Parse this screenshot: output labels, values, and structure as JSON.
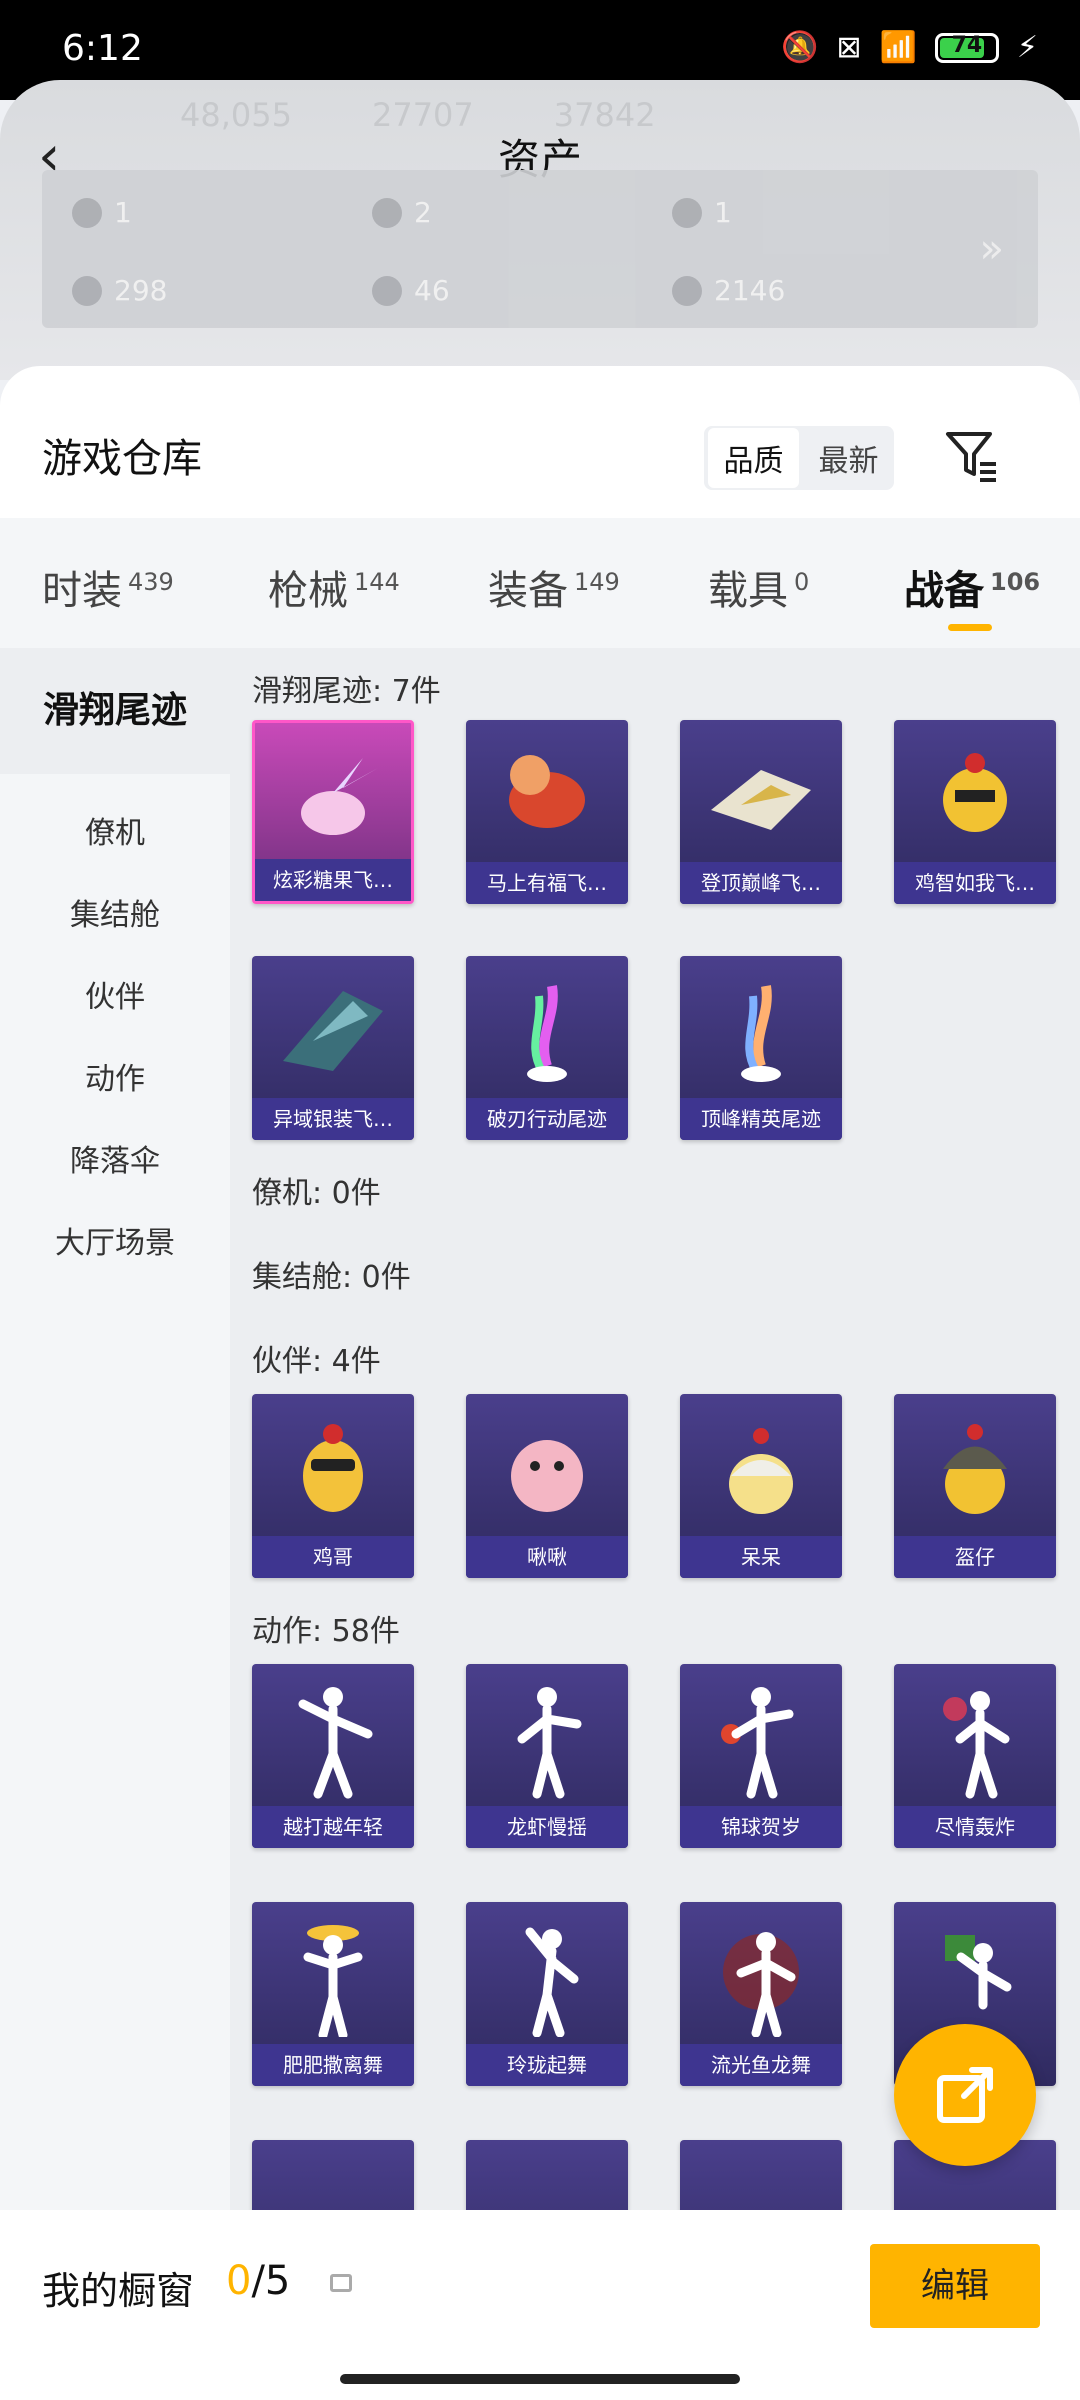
{
  "status_bar": {
    "time": "6:12",
    "battery": "74"
  },
  "header": {
    "title": "资产",
    "ghost_values": [
      "48,055",
      "27707",
      "37842"
    ],
    "assets_row1": [
      "1",
      "2",
      "1"
    ],
    "assets_row2": [
      "298",
      "46",
      "2146"
    ]
  },
  "warehouse": {
    "title": "游戏仓库",
    "sort_options": [
      "品质",
      "最新"
    ],
    "active_sort": "品质"
  },
  "tabs": [
    {
      "label": "时装",
      "count": "439"
    },
    {
      "label": "枪械",
      "count": "144"
    },
    {
      "label": "装备",
      "count": "149"
    },
    {
      "label": "载具",
      "count": "0"
    },
    {
      "label": "战备",
      "count": "106"
    }
  ],
  "sidebar": [
    "滑翔尾迹",
    "僚机",
    "集结舱",
    "伙伴",
    "动作",
    "降落伞",
    "大厅场景"
  ],
  "sections": {
    "glide_label": "滑翔尾迹: 7件",
    "glide_items": [
      "炫彩糖果飞…",
      "马上有福飞…",
      "登顶巅峰飞…",
      "鸡智如我飞…",
      "异域银装飞…",
      "破刃行动尾迹",
      "顶峰精英尾迹"
    ],
    "wingman_label": "僚机: 0件",
    "pod_label": "集结舱: 0件",
    "partner_label": "伙伴: 4件",
    "partner_items": [
      "鸡哥",
      "啾啾",
      "呆呆",
      "盔仔"
    ],
    "emote_label": "动作: 58件",
    "emote_items": [
      "越打越年轻",
      "龙虾慢摇",
      "锦球贺岁",
      "尽情轰炸",
      "肥肥撒离舞",
      "玲珑起舞",
      "流光鱼龙舞"
    ]
  },
  "bottom": {
    "label": "我的橱窗",
    "count_current": "0",
    "count_total": "/5",
    "edit": "编辑"
  }
}
